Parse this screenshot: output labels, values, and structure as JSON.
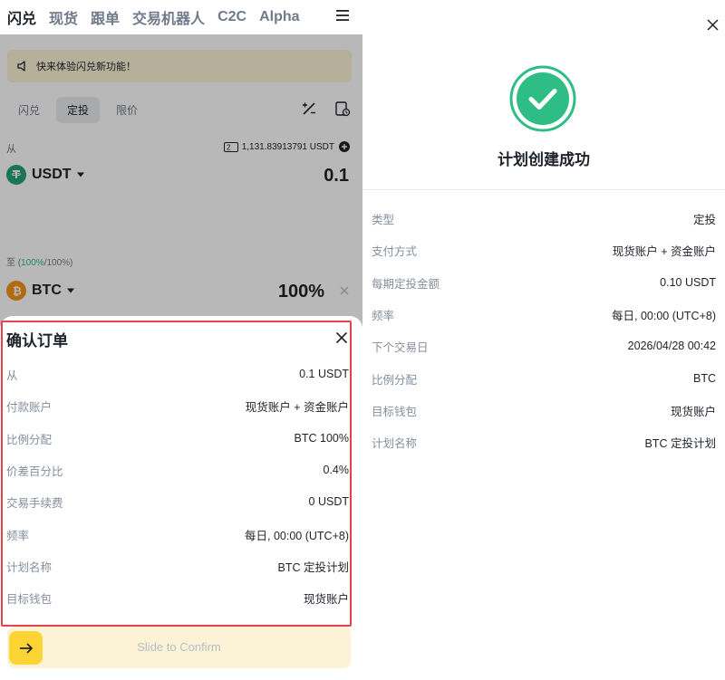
{
  "nav": {
    "items": [
      {
        "label": "闪兑",
        "active": true
      },
      {
        "label": "现货",
        "active": false
      },
      {
        "label": "跟单",
        "active": false
      },
      {
        "label": "交易机器人",
        "active": false
      },
      {
        "label": "C2C",
        "active": false
      },
      {
        "label": "Alpha",
        "active": false
      }
    ],
    "menu_icon": "hamburger-menu-icon"
  },
  "notice": {
    "text": "快来体验闪兑新功能！",
    "icon": "speaker-icon"
  },
  "subtabs": [
    {
      "label": "闪兑",
      "active": false
    },
    {
      "label": "定投",
      "active": true
    },
    {
      "label": "限价",
      "active": false
    }
  ],
  "from": {
    "label": "从",
    "balance_badge": "2",
    "balance": "1,131.83913791 USDT",
    "coin": "USDT",
    "amount": "0.1"
  },
  "to": {
    "label_prefix": "至 (",
    "label_green": "100%",
    "label_suffix": "/100%)",
    "coin": "BTC",
    "amount": "100%"
  },
  "confirm": {
    "title": "确认订单",
    "rows": [
      {
        "label": "从",
        "value": "0.1 USDT"
      },
      {
        "label": "付款账户",
        "value": "现货账户 + 资金账户"
      },
      {
        "label": "比例分配",
        "value": "BTC 100%"
      },
      {
        "label": "价差百分比",
        "value": "0.4%"
      },
      {
        "label": "交易手续费",
        "value": "0 USDT"
      },
      {
        "label": "频率",
        "value": "每日, 00:00 (UTC+8)"
      },
      {
        "label": "计划名称",
        "value": "BTC 定投计划"
      },
      {
        "label": "目标钱包",
        "value": "现货账户"
      }
    ],
    "slider_text": "Slide to Confirm"
  },
  "success": {
    "title": "计划创建成功",
    "rows": [
      {
        "label": "类型",
        "value": "定投"
      },
      {
        "label": "支付方式",
        "value": "现货账户 + 资金账户"
      },
      {
        "label": "每期定投金额",
        "value": "0.10 USDT"
      },
      {
        "label": "频率",
        "value": "每日, 00:00 (UTC+8)"
      },
      {
        "label": "下个交易日",
        "value": "2026/04/28 00:42"
      },
      {
        "label": "比例分配",
        "value": "BTC"
      },
      {
        "label": "目标钱包",
        "value": "现货账户"
      },
      {
        "label": "计划名称",
        "value": "BTC 定投计划"
      }
    ]
  },
  "colors": {
    "accent_yellow": "#fcd535",
    "success_green": "#2ebd85",
    "highlight_red": "#e84148",
    "usdt": "#26a17b",
    "btc": "#f7931a"
  }
}
